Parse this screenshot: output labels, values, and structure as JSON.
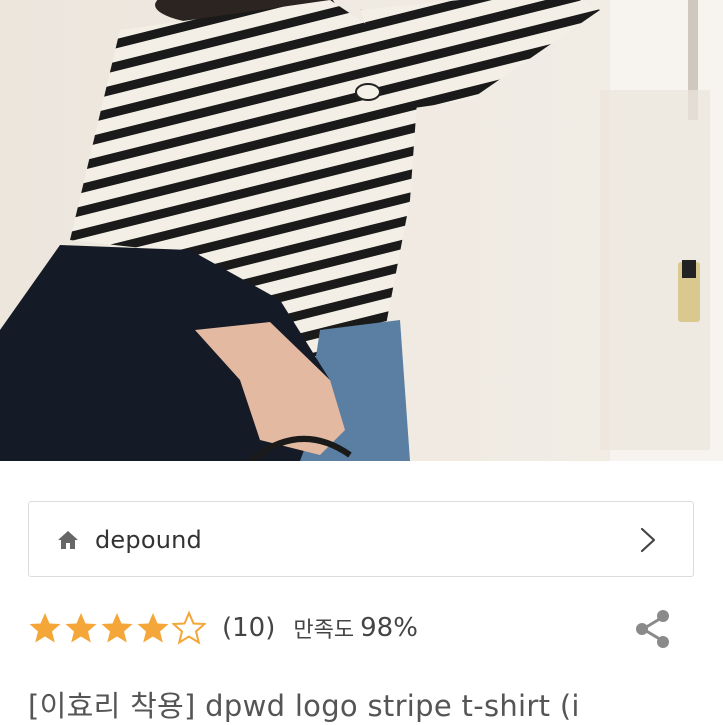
{
  "product_image": {
    "alt": ""
  },
  "shop": {
    "name": "depound",
    "icon": "home-icon",
    "nav_icon": "chevron-right-icon"
  },
  "rating": {
    "stars": 4.5,
    "max_stars": 5,
    "review_count": "(10)",
    "satisfaction_label": "만족도",
    "satisfaction_value": "98%",
    "star_color": "#f4a638"
  },
  "share": {
    "icon": "share-icon"
  },
  "product": {
    "title": "[이효리 착용] dpwd logo stripe t-shirt (i"
  }
}
